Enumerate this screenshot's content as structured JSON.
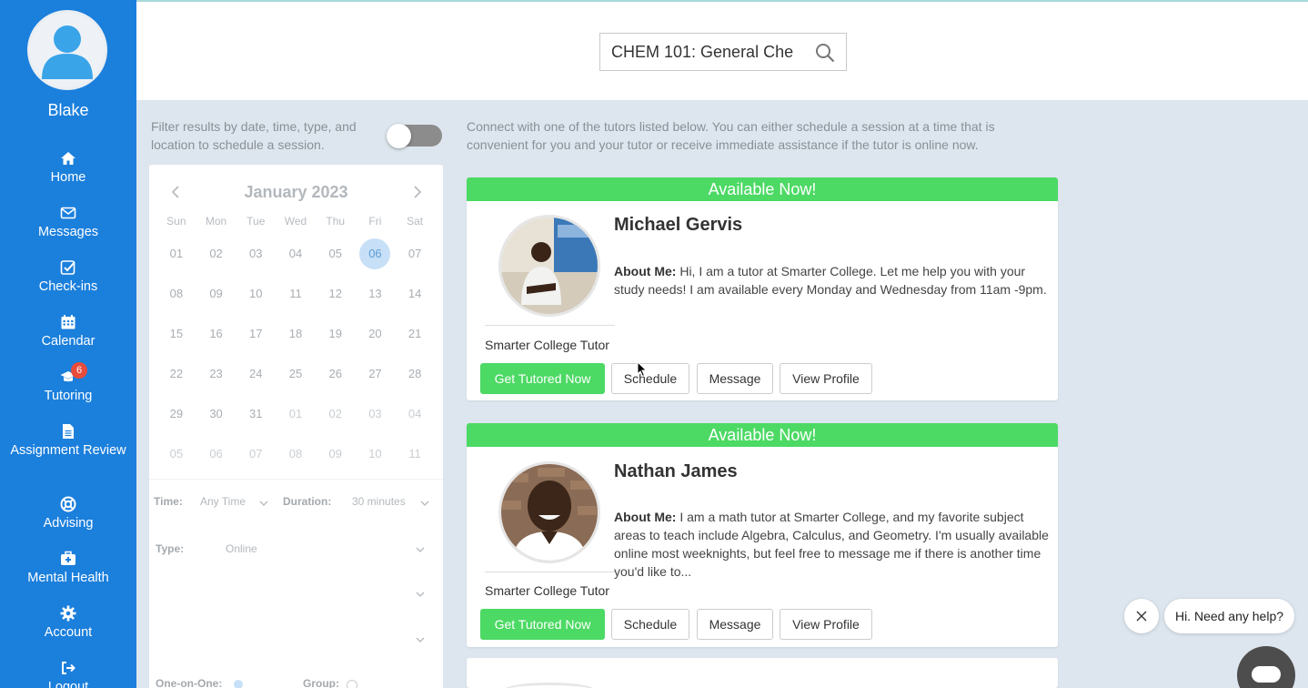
{
  "user": {
    "name": "Blake"
  },
  "nav": [
    {
      "id": "home",
      "label": "Home",
      "icon": "home-icon"
    },
    {
      "id": "messages",
      "label": "Messages",
      "icon": "envelope-icon"
    },
    {
      "id": "checkins",
      "label": "Check-ins",
      "icon": "checkbox-icon"
    },
    {
      "id": "calendar",
      "label": "Calendar",
      "icon": "calendar-icon"
    },
    {
      "id": "tutoring",
      "label": "Tutoring",
      "icon": "graduation-cap-icon",
      "badge": "6"
    },
    {
      "id": "assignment-review",
      "label": "Assignment Review",
      "icon": "document-icon"
    },
    {
      "id": "advising",
      "label": "Advising",
      "icon": "lifebuoy-icon"
    },
    {
      "id": "mental-health",
      "label": "Mental Health",
      "icon": "medical-kit-icon"
    },
    {
      "id": "account",
      "label": "Account",
      "icon": "gear-icon"
    },
    {
      "id": "logout",
      "label": "Logout",
      "icon": "logout-icon"
    }
  ],
  "search": {
    "value": "CHEM 101: General Che"
  },
  "filter": {
    "description": "Filter results by date, time, type, and location to schedule a session."
  },
  "intro": "Connect with one of the tutors listed below. You can either schedule a session at a time that is convenient for you and your tutor or receive immediate assistance if the tutor is online now.",
  "calendar": {
    "month": "January 2023",
    "weekdays": [
      "Sun",
      "Mon",
      "Tue",
      "Wed",
      "Thu",
      "Fri",
      "Sat"
    ],
    "days": [
      [
        "01",
        "02",
        "03",
        "04",
        "05",
        "06",
        "07"
      ],
      [
        "08",
        "09",
        "10",
        "11",
        "12",
        "13",
        "14"
      ],
      [
        "15",
        "16",
        "17",
        "18",
        "19",
        "20",
        "21"
      ],
      [
        "22",
        "23",
        "24",
        "25",
        "26",
        "27",
        "28"
      ],
      [
        "29",
        "30",
        "31",
        "01",
        "02",
        "03",
        "04"
      ],
      [
        "05",
        "06",
        "07",
        "08",
        "09",
        "10",
        "11"
      ]
    ],
    "selected": "06"
  },
  "filters": {
    "time_label": "Time:",
    "time_value": "Any Time",
    "duration_label": "Duration:",
    "duration_value": "30 minutes",
    "type_label": "Type:",
    "type_value": "Online",
    "one_on_one_label": "One-on-One:",
    "group_label": "Group:"
  },
  "tutors": [
    {
      "banner": "Available Now!",
      "name": "Michael Gervis",
      "about_label": "About Me:",
      "about": " Hi, I am a tutor at Smarter College. Let me help you with your study needs! I am available every Monday and Wednesday from 11am -9pm.",
      "role": "Smarter College Tutor"
    },
    {
      "banner": "Available Now!",
      "name": "Nathan James",
      "about_label": "About Me:",
      "about": " I am a math tutor at Smarter College, and my favorite subject areas to teach include Algebra, Calculus, and Geometry. I'm usually available online most weeknights, but feel free to message me if there is another time you'd like to...",
      "role": "Smarter College Tutor"
    }
  ],
  "buttons": {
    "tutor_now": "Get Tutored Now",
    "schedule": "Schedule",
    "message": "Message",
    "profile": "View Profile"
  },
  "help": {
    "prompt": "Hi. Need any help?"
  },
  "colors": {
    "sidebar": "#1b7fdc",
    "accent_green": "#4cd964",
    "badge_red": "#e74c3c"
  }
}
